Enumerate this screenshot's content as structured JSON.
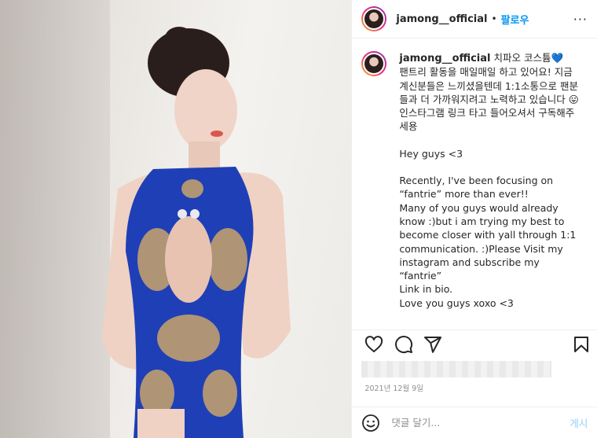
{
  "post": {
    "username": "jamong__official",
    "follow_label": "팔로우",
    "dot": "•",
    "more": "···",
    "caption_title": "치파오 코스튬💙",
    "caption_ko": "팬트리 활동을 매일매일 하고 있어요! 지금 계신분들은 느끼셨을텐데 1:1소통으로 팬분들과 더 가까워지려고 노력하고 있습니다 😛\n인스타그램 링크 타고 들어오셔서 구독해주세용",
    "caption_en1": "Hey guys <3",
    "caption_en2": "Recently, I've been focusing on “fantrie” more than ever!!\nMany of you guys would already know :)but i am trying my best to become closer with yall through 1:1 communication. :)Please Visit my instagram and subscribe my “fantrie”\nLink in bio.\nLove you guys xoxo <3",
    "date": "2021년 12월 9일",
    "comment_placeholder": "댓글 달기...",
    "post_button": "게시"
  },
  "colors": {
    "follow": "#0095f6",
    "post_disabled": "#b2dffc",
    "dress": "#1f3fb6",
    "pattern": "#c9a36a"
  },
  "icons": [
    "more-icon",
    "heart-icon",
    "comment-icon",
    "share-icon",
    "bookmark-icon",
    "emoji-icon"
  ]
}
